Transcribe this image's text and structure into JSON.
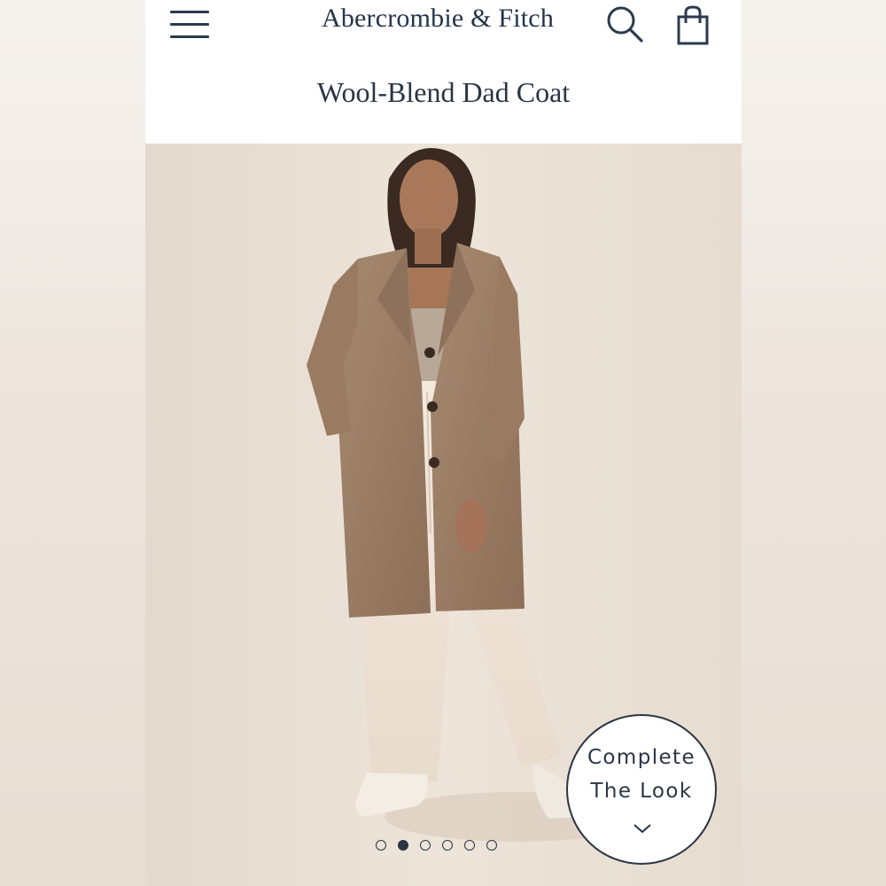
{
  "header": {
    "brand": "Abercrombie & Fitch",
    "menu_icon": "hamburger-menu-icon",
    "search_icon": "search-icon",
    "bag_icon": "shopping-bag-icon"
  },
  "product": {
    "title": "Wool-Blend Dad Coat"
  },
  "gallery": {
    "image_count": 6,
    "active_index": 2
  },
  "complete_the_look": {
    "line1": "Complete",
    "line2": "The Look",
    "icon": "chevron-down-icon"
  },
  "colors": {
    "text": "#24344a",
    "coat": "#9c7d63",
    "pants": "#efe3d6",
    "background": "#e9e0d7"
  }
}
